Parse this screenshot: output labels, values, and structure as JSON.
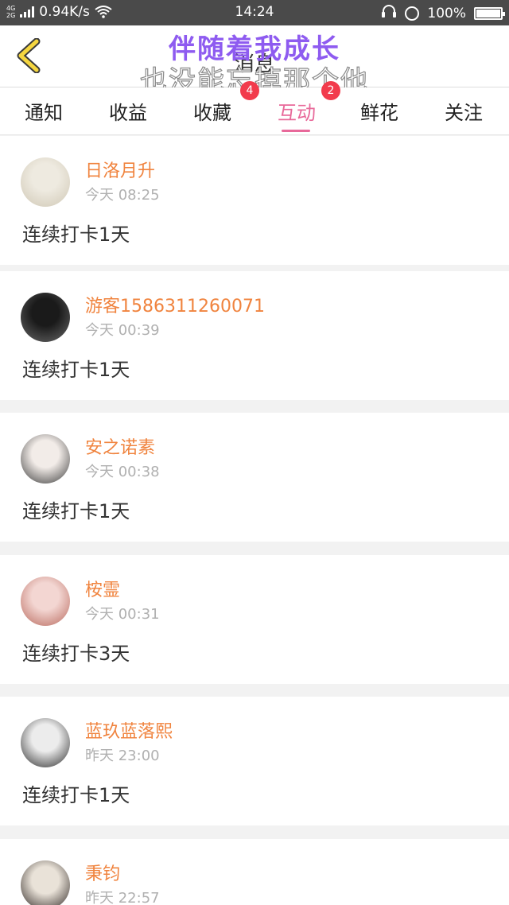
{
  "status_bar": {
    "network_type_top": "4G",
    "network_type_bottom": "2G",
    "speed": "0.94K/s",
    "time": "14:24",
    "battery": "100%",
    "battery_level": 1.0
  },
  "header": {
    "title": "消息",
    "overlay_line1": "伴随着我成长",
    "overlay_line2": "也没能忘掉那个他"
  },
  "tabs": [
    {
      "label": "通知",
      "active": false,
      "badge": ""
    },
    {
      "label": "收益",
      "active": false,
      "badge": ""
    },
    {
      "label": "收藏",
      "active": false,
      "badge": "4"
    },
    {
      "label": "互动",
      "active": true,
      "badge": "2"
    },
    {
      "label": "鲜花",
      "active": false,
      "badge": ""
    },
    {
      "label": "关注",
      "active": false,
      "badge": ""
    }
  ],
  "feed": [
    {
      "name": "日洛月升",
      "time": "今天 08:25",
      "content": "连续打卡1天",
      "avatar_colors": [
        "#eeeae0",
        "#cfc7b4"
      ]
    },
    {
      "name": "游客15863112600​71",
      "time": "今天 00:39",
      "content": "连续打卡1天",
      "avatar_colors": [
        "#1a1a1a",
        "#6a6a6a"
      ]
    },
    {
      "name": "安之诺素",
      "time": "今天 00:38",
      "content": "连续打卡1天",
      "avatar_colors": [
        "#f2ece8",
        "#3a3a3a"
      ]
    },
    {
      "name": "桉霊",
      "time": "今天 00:31",
      "content": "连续打卡3天",
      "avatar_colors": [
        "#f3d6d2",
        "#b8685c"
      ]
    },
    {
      "name": "蓝玖蓝落熙",
      "time": "昨天 23:00",
      "content": "连续打卡1天",
      "avatar_colors": [
        "#ececec",
        "#2a2a2a"
      ]
    },
    {
      "name": "秉钧",
      "time": "昨天 22:57",
      "content": "",
      "avatar_colors": [
        "#e9e2d8",
        "#2b2320"
      ]
    }
  ]
}
